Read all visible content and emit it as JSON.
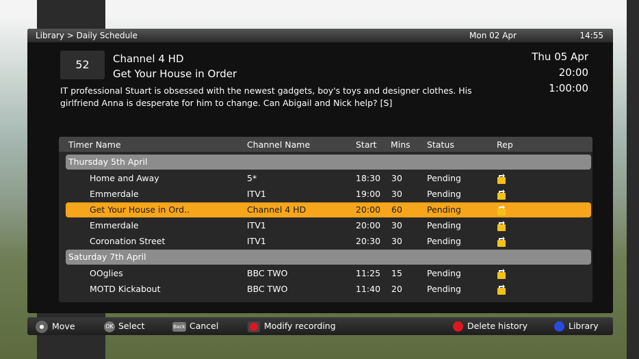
{
  "header": {
    "breadcrumb": "Library > Daily Schedule",
    "date": "Mon 02 Apr",
    "time": "14:55"
  },
  "info": {
    "channel_number": "52",
    "channel_name": "Channel 4 HD",
    "programme_title": "Get Your House in Order",
    "description": "IT professional Stuart is obsessed with the newest gadgets, boy's toys and designer clothes. His girlfriend Anna is desperate for him to change. Can Abigail and Nick help? [S]",
    "date": "Thu 05 Apr",
    "start_time": "20:00",
    "duration": "1:00:00"
  },
  "table": {
    "columns": {
      "timer_name": "Timer Name",
      "channel_name": "Channel Name",
      "start": "Start",
      "mins": "Mins",
      "status": "Status",
      "rep": "Rep"
    },
    "groups": [
      {
        "label": "Thursday 5th April",
        "rows": [
          {
            "name": "Home and Away",
            "channel": "5*",
            "start": "18:30",
            "mins": "30",
            "status": "Pending",
            "rep_icon": "repeat-icon",
            "selected": false
          },
          {
            "name": "Emmerdale",
            "channel": "ITV1",
            "start": "19:00",
            "mins": "30",
            "status": "Pending",
            "rep_icon": "repeat-icon",
            "selected": false
          },
          {
            "name": "Get Your House in Ord..",
            "channel": "Channel 4 HD",
            "start": "20:00",
            "mins": "60",
            "status": "Pending",
            "rep_icon": "repeat-icon",
            "selected": true
          },
          {
            "name": "Emmerdale",
            "channel": "ITV1",
            "start": "20:00",
            "mins": "30",
            "status": "Pending",
            "rep_icon": "repeat-icon",
            "selected": false
          },
          {
            "name": "Coronation Street",
            "channel": "ITV1",
            "start": "20:30",
            "mins": "30",
            "status": "Pending",
            "rep_icon": "repeat-icon",
            "selected": false
          }
        ]
      },
      {
        "label": "Saturday 7th April",
        "rows": [
          {
            "name": "OOglies",
            "channel": "BBC TWO",
            "start": "11:25",
            "mins": "15",
            "status": "Pending",
            "rep_icon": "repeat-icon",
            "selected": false
          },
          {
            "name": "MOTD Kickabout",
            "channel": "BBC TWO",
            "start": "11:40",
            "mins": "20",
            "status": "Pending",
            "rep_icon": "repeat-icon",
            "selected": false
          }
        ]
      }
    ]
  },
  "footer": {
    "move": "Move",
    "ok_key": "OK",
    "select": "Select",
    "back_key": "Back",
    "cancel": "Cancel",
    "modify": "Modify recording",
    "delete_history": "Delete history",
    "library": "Library"
  },
  "colors": {
    "highlight": "#f7a51a",
    "red": "#e0161e",
    "blue": "#2a4ae0",
    "rep_icon": "#f2c21a"
  }
}
